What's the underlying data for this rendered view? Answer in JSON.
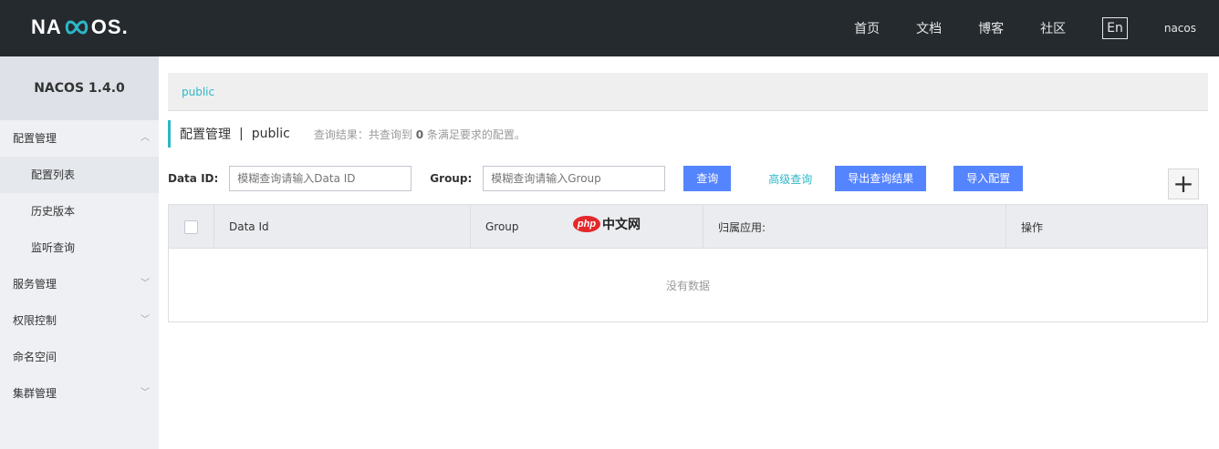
{
  "header": {
    "logo_text_left": "NA",
    "logo_text_right": "OS.",
    "nav": [
      "首页",
      "文档",
      "博客",
      "社区"
    ],
    "lang": "En",
    "user": "nacos"
  },
  "sidebar": {
    "title": "NACOS 1.4.0",
    "items": [
      {
        "label": "配置管理"
      },
      {
        "label": "配置列表"
      },
      {
        "label": "历史版本"
      },
      {
        "label": "监听查询"
      },
      {
        "label": "服务管理"
      },
      {
        "label": "权限控制"
      },
      {
        "label": "命名空间"
      },
      {
        "label": "集群管理"
      }
    ]
  },
  "main": {
    "namespace": "public",
    "page_title": "配置管理",
    "title_separator": "|",
    "title_namespace": "public",
    "result_prefix": "查询结果：共查询到",
    "result_count": "0",
    "result_suffix": "条满足要求的配置。",
    "filter": {
      "dataid_label": "Data ID:",
      "dataid_placeholder": "模糊查询请输入Data ID",
      "group_label": "Group:",
      "group_placeholder": "模糊查询请输入Group",
      "query_button": "查询",
      "advanced_link": "高级查询",
      "export_button": "导出查询结果",
      "import_button": "导入配置"
    },
    "table": {
      "columns": [
        "Data Id",
        "Group",
        "归属应用:",
        "操作"
      ],
      "empty_text": "没有数据"
    },
    "watermark": {
      "badge": "php",
      "text": "中文网"
    }
  },
  "colors": {
    "header_bg": "#252a2f",
    "accent": "#2db7c8",
    "primary_button": "#5584ff"
  }
}
